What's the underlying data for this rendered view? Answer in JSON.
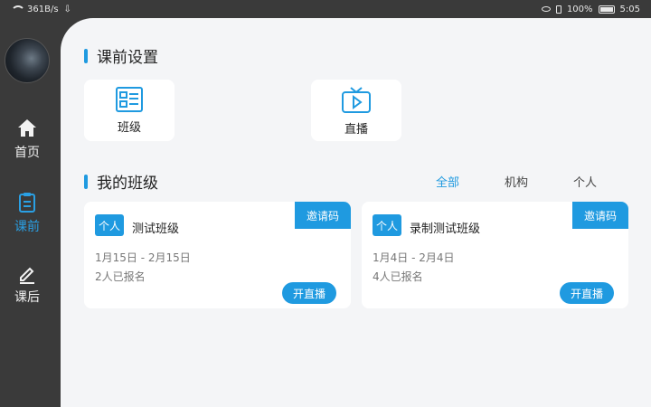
{
  "status": {
    "speed": "361B/s",
    "battery": "100%",
    "time": "5:05"
  },
  "sidebar": {
    "items": [
      {
        "label": "首页",
        "icon": "home-icon"
      },
      {
        "label": "课前",
        "icon": "clipboard-icon"
      },
      {
        "label": "课后",
        "icon": "edit-icon"
      }
    ],
    "active_color": "#2aa0e4"
  },
  "pre_class": {
    "title": "课前设置",
    "tiles": [
      {
        "label": "班级",
        "icon": "class-list-icon"
      },
      {
        "label": "直播",
        "icon": "tv-play-icon"
      }
    ]
  },
  "my_classes": {
    "title": "我的班级",
    "filters": [
      "全部",
      "机构",
      "个人"
    ],
    "active_filter": "全部",
    "cards": [
      {
        "tag": "个人",
        "name": "测试班级",
        "invite_label": "邀请码",
        "dates": "1月15日 - 2月15日",
        "enrolled": "2人已报名",
        "live_label": "开直播"
      },
      {
        "tag": "个人",
        "name": "录制测试班级",
        "invite_label": "邀请码",
        "dates": "1月4日 - 2月4日",
        "enrolled": "4人已报名",
        "live_label": "开直播"
      }
    ]
  },
  "accent_color": "#1f9ae0"
}
